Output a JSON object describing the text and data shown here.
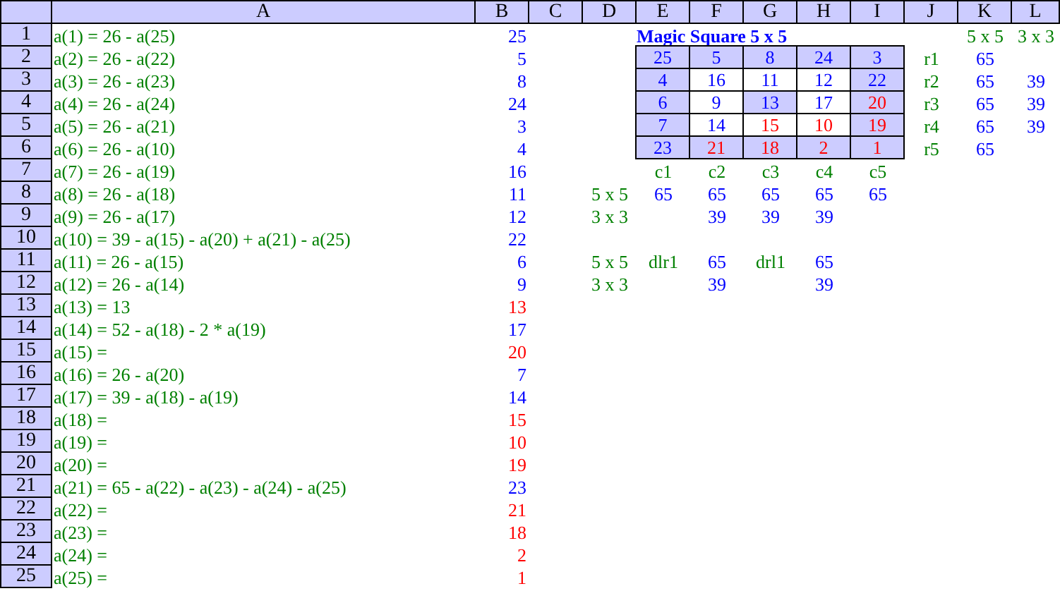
{
  "columns": [
    "A",
    "B",
    "C",
    "D",
    "E",
    "F",
    "G",
    "H",
    "I",
    "J",
    "K",
    "L"
  ],
  "rows": [
    {
      "header": "1",
      "a": {
        "kind": "formula",
        "text": "a(1) = 26 - a(25)",
        "color": "#008000"
      },
      "b": {
        "kind": "value",
        "text": "25",
        "color": "#0000ff"
      },
      "e": {
        "kind": "title",
        "text": "Magic Square 5 x 5",
        "color": "#0000ff"
      },
      "k": {
        "kind": "label",
        "text": "5 x 5",
        "color": "#008000"
      },
      "l": {
        "kind": "label",
        "text": "3 x 3",
        "color": "#008000"
      }
    },
    {
      "header": "2",
      "a": {
        "kind": "formula",
        "text": "a(2) = 26 - a(22)",
        "color": "#008000"
      },
      "b": {
        "kind": "value",
        "text": "5",
        "color": "#0000ff"
      },
      "e": {
        "kind": "square",
        "text": "25",
        "color": "#0000ff",
        "shaded": true
      },
      "f": {
        "kind": "square",
        "text": "5",
        "color": "#0000ff",
        "shaded": true
      },
      "g": {
        "kind": "square",
        "text": "8",
        "color": "#0000ff",
        "shaded": true
      },
      "h": {
        "kind": "square",
        "text": "24",
        "color": "#0000ff",
        "shaded": true
      },
      "i": {
        "kind": "square",
        "text": "3",
        "color": "#0000ff",
        "shaded": true
      },
      "j": {
        "kind": "label",
        "text": "r1",
        "color": "#008000"
      },
      "k": {
        "kind": "label",
        "text": "65",
        "color": "#0000ff"
      }
    },
    {
      "header": "3",
      "a": {
        "kind": "formula",
        "text": "a(3) = 26 - a(23)",
        "color": "#008000"
      },
      "b": {
        "kind": "value",
        "text": "8",
        "color": "#0000ff"
      },
      "e": {
        "kind": "square",
        "text": "4",
        "color": "#0000ff",
        "shaded": true
      },
      "f": {
        "kind": "square",
        "text": "16",
        "color": "#0000ff",
        "shaded": false
      },
      "g": {
        "kind": "square",
        "text": "11",
        "color": "#0000ff",
        "shaded": false
      },
      "h": {
        "kind": "square",
        "text": "12",
        "color": "#0000ff",
        "shaded": false
      },
      "i": {
        "kind": "square",
        "text": "22",
        "color": "#0000ff",
        "shaded": true
      },
      "j": {
        "kind": "label",
        "text": "r2",
        "color": "#008000"
      },
      "k": {
        "kind": "label",
        "text": "65",
        "color": "#0000ff"
      },
      "l": {
        "kind": "label",
        "text": "39",
        "color": "#0000ff"
      }
    },
    {
      "header": "4",
      "a": {
        "kind": "formula",
        "text": "a(4) = 26 - a(24)",
        "color": "#008000"
      },
      "b": {
        "kind": "value",
        "text": "24",
        "color": "#0000ff"
      },
      "e": {
        "kind": "square",
        "text": "6",
        "color": "#0000ff",
        "shaded": true
      },
      "f": {
        "kind": "square",
        "text": "9",
        "color": "#0000ff",
        "shaded": false
      },
      "g": {
        "kind": "square",
        "text": "13",
        "color": "#0000ff",
        "shaded": true
      },
      "h": {
        "kind": "square",
        "text": "17",
        "color": "#0000ff",
        "shaded": false
      },
      "i": {
        "kind": "square",
        "text": "20",
        "color": "#ff0000",
        "shaded": true
      },
      "j": {
        "kind": "label",
        "text": "r3",
        "color": "#008000"
      },
      "k": {
        "kind": "label",
        "text": "65",
        "color": "#0000ff"
      },
      "l": {
        "kind": "label",
        "text": "39",
        "color": "#0000ff"
      }
    },
    {
      "header": "5",
      "a": {
        "kind": "formula",
        "text": "a(5) = 26 - a(21)",
        "color": "#008000"
      },
      "b": {
        "kind": "value",
        "text": "3",
        "color": "#0000ff"
      },
      "e": {
        "kind": "square",
        "text": "7",
        "color": "#0000ff",
        "shaded": true
      },
      "f": {
        "kind": "square",
        "text": "14",
        "color": "#0000ff",
        "shaded": false
      },
      "g": {
        "kind": "square",
        "text": "15",
        "color": "#ff0000",
        "shaded": false
      },
      "h": {
        "kind": "square",
        "text": "10",
        "color": "#ff0000",
        "shaded": false
      },
      "i": {
        "kind": "square",
        "text": "19",
        "color": "#ff0000",
        "shaded": true
      },
      "j": {
        "kind": "label",
        "text": "r4",
        "color": "#008000"
      },
      "k": {
        "kind": "label",
        "text": "65",
        "color": "#0000ff"
      },
      "l": {
        "kind": "label",
        "text": "39",
        "color": "#0000ff"
      }
    },
    {
      "header": "6",
      "a": {
        "kind": "formula",
        "text": "a(6) = 26 - a(10)",
        "color": "#008000"
      },
      "b": {
        "kind": "value",
        "text": "4",
        "color": "#0000ff"
      },
      "e": {
        "kind": "square",
        "text": "23",
        "color": "#0000ff",
        "shaded": true
      },
      "f": {
        "kind": "square",
        "text": "21",
        "color": "#ff0000",
        "shaded": true
      },
      "g": {
        "kind": "square",
        "text": "18",
        "color": "#ff0000",
        "shaded": true
      },
      "h": {
        "kind": "square",
        "text": "2",
        "color": "#ff0000",
        "shaded": true
      },
      "i": {
        "kind": "square",
        "text": "1",
        "color": "#ff0000",
        "shaded": true
      },
      "j": {
        "kind": "label",
        "text": "r5",
        "color": "#008000"
      },
      "k": {
        "kind": "label",
        "text": "65",
        "color": "#0000ff"
      }
    },
    {
      "header": "7",
      "a": {
        "kind": "formula",
        "text": "a(7) = 26 - a(19)",
        "color": "#008000"
      },
      "b": {
        "kind": "value",
        "text": "16",
        "color": "#0000ff"
      },
      "e": {
        "kind": "label",
        "text": "c1",
        "color": "#008000"
      },
      "f": {
        "kind": "label",
        "text": "c2",
        "color": "#008000"
      },
      "g": {
        "kind": "label",
        "text": "c3",
        "color": "#008000"
      },
      "h": {
        "kind": "label",
        "text": "c4",
        "color": "#008000"
      },
      "i": {
        "kind": "label",
        "text": "c5",
        "color": "#008000"
      }
    },
    {
      "header": "8",
      "a": {
        "kind": "formula",
        "text": "a(8) = 26 - a(18)",
        "color": "#008000"
      },
      "b": {
        "kind": "value",
        "text": "11",
        "color": "#0000ff"
      },
      "d": {
        "kind": "label",
        "text": "5 x 5",
        "color": "#008000"
      },
      "e": {
        "kind": "label",
        "text": "65",
        "color": "#0000ff"
      },
      "f": {
        "kind": "label",
        "text": "65",
        "color": "#0000ff"
      },
      "g": {
        "kind": "label",
        "text": "65",
        "color": "#0000ff"
      },
      "h": {
        "kind": "label",
        "text": "65",
        "color": "#0000ff"
      },
      "i": {
        "kind": "label",
        "text": "65",
        "color": "#0000ff"
      }
    },
    {
      "header": "9",
      "a": {
        "kind": "formula",
        "text": "a(9) = 26 - a(17)",
        "color": "#008000"
      },
      "b": {
        "kind": "value",
        "text": "12",
        "color": "#0000ff"
      },
      "d": {
        "kind": "label",
        "text": "3 x 3",
        "color": "#008000"
      },
      "f": {
        "kind": "label",
        "text": "39",
        "color": "#0000ff"
      },
      "g": {
        "kind": "label",
        "text": "39",
        "color": "#0000ff"
      },
      "h": {
        "kind": "label",
        "text": "39",
        "color": "#0000ff"
      }
    },
    {
      "header": "10",
      "a": {
        "kind": "formula",
        "text": "a(10) = 39 - a(15) - a(20) + a(21) - a(25)",
        "color": "#008000"
      },
      "b": {
        "kind": "value",
        "text": "22",
        "color": "#0000ff"
      }
    },
    {
      "header": "11",
      "a": {
        "kind": "formula",
        "text": "a(11) = 26 - a(15)",
        "color": "#008000"
      },
      "b": {
        "kind": "value",
        "text": "6",
        "color": "#0000ff"
      },
      "d": {
        "kind": "label",
        "text": "5 x 5",
        "color": "#008000"
      },
      "e": {
        "kind": "label",
        "text": "dlr1",
        "color": "#008000"
      },
      "f": {
        "kind": "label",
        "text": "65",
        "color": "#0000ff"
      },
      "g": {
        "kind": "label",
        "text": "drl1",
        "color": "#008000"
      },
      "h": {
        "kind": "label",
        "text": "65",
        "color": "#0000ff"
      }
    },
    {
      "header": "12",
      "a": {
        "kind": "formula",
        "text": "a(12) = 26 - a(14)",
        "color": "#008000"
      },
      "b": {
        "kind": "value",
        "text": "9",
        "color": "#0000ff"
      },
      "d": {
        "kind": "label",
        "text": "3 x 3",
        "color": "#008000"
      },
      "f": {
        "kind": "label",
        "text": "39",
        "color": "#0000ff"
      },
      "h": {
        "kind": "label",
        "text": "39",
        "color": "#0000ff"
      }
    },
    {
      "header": "13",
      "a": {
        "kind": "formula",
        "text": "a(13) = 13",
        "color": "#008000"
      },
      "b": {
        "kind": "value",
        "text": "13",
        "color": "#ff0000"
      }
    },
    {
      "header": "14",
      "a": {
        "kind": "formula",
        "text": "a(14) = 52 - a(18) - 2 * a(19)",
        "color": "#008000"
      },
      "b": {
        "kind": "value",
        "text": "17",
        "color": "#0000ff"
      }
    },
    {
      "header": "15",
      "a": {
        "kind": "formula",
        "text": "a(15) =",
        "color": "#008000"
      },
      "b": {
        "kind": "value",
        "text": "20",
        "color": "#ff0000"
      }
    },
    {
      "header": "16",
      "a": {
        "kind": "formula",
        "text": "a(16) = 26 - a(20)",
        "color": "#008000"
      },
      "b": {
        "kind": "value",
        "text": "7",
        "color": "#0000ff"
      }
    },
    {
      "header": "17",
      "a": {
        "kind": "formula",
        "text": "a(17) = 39 - a(18) - a(19)",
        "color": "#008000"
      },
      "b": {
        "kind": "value",
        "text": "14",
        "color": "#0000ff"
      }
    },
    {
      "header": "18",
      "a": {
        "kind": "formula",
        "text": "a(18) =",
        "color": "#008000"
      },
      "b": {
        "kind": "value",
        "text": "15",
        "color": "#ff0000"
      }
    },
    {
      "header": "19",
      "a": {
        "kind": "formula",
        "text": "a(19) =",
        "color": "#008000"
      },
      "b": {
        "kind": "value",
        "text": "10",
        "color": "#ff0000"
      }
    },
    {
      "header": "20",
      "a": {
        "kind": "formula",
        "text": "a(20) =",
        "color": "#008000"
      },
      "b": {
        "kind": "value",
        "text": "19",
        "color": "#ff0000"
      }
    },
    {
      "header": "21",
      "a": {
        "kind": "formula",
        "text": "a(21) = 65 - a(22) - a(23) - a(24) - a(25)",
        "color": "#008000"
      },
      "b": {
        "kind": "value",
        "text": "23",
        "color": "#0000ff"
      }
    },
    {
      "header": "22",
      "a": {
        "kind": "formula",
        "text": "a(22) =",
        "color": "#008000"
      },
      "b": {
        "kind": "value",
        "text": "21",
        "color": "#ff0000"
      }
    },
    {
      "header": "23",
      "a": {
        "kind": "formula",
        "text": "a(23) =",
        "color": "#008000"
      },
      "b": {
        "kind": "value",
        "text": "18",
        "color": "#ff0000"
      }
    },
    {
      "header": "24",
      "a": {
        "kind": "formula",
        "text": "a(24) =",
        "color": "#008000"
      },
      "b": {
        "kind": "value",
        "text": "2",
        "color": "#ff0000"
      }
    },
    {
      "header": "25",
      "a": {
        "kind": "formula",
        "text": "a(25) =",
        "color": "#008000"
      },
      "b": {
        "kind": "value",
        "text": "1",
        "color": "#ff0000"
      }
    }
  ]
}
